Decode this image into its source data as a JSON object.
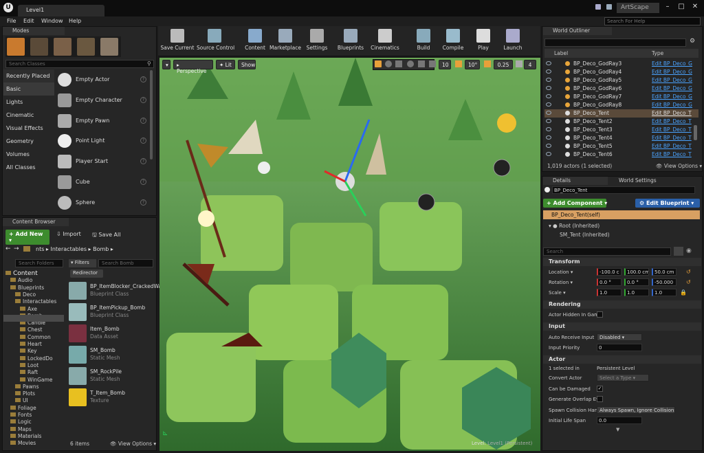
{
  "window": {
    "doc_tab": "Level1",
    "brand": "ArtScape",
    "help_search": "Search For Help"
  },
  "menu": [
    "File",
    "Edit",
    "Window",
    "Help"
  ],
  "modes": {
    "tab": "Modes",
    "search_placeholder": "Search Classes",
    "categories": [
      "Recently Placed",
      "Basic",
      "Lights",
      "Cinematic",
      "Visual Effects",
      "Geometry",
      "Volumes",
      "All Classes"
    ],
    "items": [
      "Empty Actor",
      "Empty Character",
      "Empty Pawn",
      "Point Light",
      "Player Start",
      "Cube",
      "Sphere"
    ]
  },
  "content_browser": {
    "tab": "Content Browser",
    "add_new": "Add New",
    "import": "Import",
    "save_all": "Save All",
    "path": [
      "nts",
      "Interactables",
      "Bomb"
    ],
    "folder_search": "Search Folders",
    "filters": "Filters",
    "asset_search": "Search Bomb",
    "filter_chip": "Redirector",
    "count": "6 items",
    "view_options": "View Options",
    "folders": [
      "Content",
      "Audio",
      "Blueprints",
      "Deco",
      "Interactables",
      "Axe",
      "Bomb",
      "Candle",
      "Chest",
      "Common",
      "Heart",
      "Key",
      "LockedDo",
      "Loot",
      "Raft",
      "WinGame",
      "Pawns",
      "Plots",
      "UI",
      "Foliage",
      "Fonts",
      "Logic",
      "Maps",
      "Materials",
      "Movies"
    ],
    "assets": [
      {
        "name": "BP_ItemBlocker_CrackedWa",
        "type": "Blueprint Class"
      },
      {
        "name": "BP_ItemPickup_Bomb",
        "type": "Blueprint Class"
      },
      {
        "name": "Item_Bomb",
        "type": "Data Asset"
      },
      {
        "name": "SM_Bomb",
        "type": "Static Mesh"
      },
      {
        "name": "SM_RockPile",
        "type": "Static Mesh"
      },
      {
        "name": "T_Item_Bomb",
        "type": "Texture"
      }
    ]
  },
  "toolbar": [
    "Save Current",
    "Source Control",
    "Content",
    "Marketplace",
    "Settings",
    "Blueprints",
    "Cinematics",
    "Build",
    "Compile",
    "Play",
    "Launch"
  ],
  "viewport": {
    "perspective": "Perspective",
    "lit": "Lit",
    "show": "Show",
    "grid": "10",
    "angle": "10°",
    "scale": "0.25",
    "cams": "4",
    "level_label": "Level:",
    "level_name": "Level1 (Persistent)"
  },
  "outliner": {
    "tab": "World Outliner",
    "col_label": "Label",
    "col_type": "Type",
    "rows": [
      {
        "label": "BP_Deco_GodRay3",
        "type": "Edit BP_Deco_G"
      },
      {
        "label": "BP_Deco_GodRay4",
        "type": "Edit BP_Deco_G"
      },
      {
        "label": "BP_Deco_GodRay5",
        "type": "Edit BP_Deco_G"
      },
      {
        "label": "BP_Deco_GodRay6",
        "type": "Edit BP_Deco_G"
      },
      {
        "label": "BP_Deco_GodRay7",
        "type": "Edit BP_Deco_G"
      },
      {
        "label": "BP_Deco_GodRay8",
        "type": "Edit BP_Deco_G"
      },
      {
        "label": "BP_Deco_Tent",
        "type": "Edit BP_Deco_T"
      },
      {
        "label": "BP_Deco_Tent2",
        "type": "Edit BP_Deco_T"
      },
      {
        "label": "BP_Deco_Tent3",
        "type": "Edit BP_Deco_T"
      },
      {
        "label": "BP_Deco_Tent4",
        "type": "Edit BP_Deco_T"
      },
      {
        "label": "BP_Deco_Tent5",
        "type": "Edit BP_Deco_T"
      },
      {
        "label": "BP_Deco_Tent6",
        "type": "Edit BP_Deco_T"
      }
    ],
    "status": "1,019 actors (1 selected)",
    "view_options": "View Options"
  },
  "details": {
    "tab": "Details",
    "tab2": "World Settings",
    "name": "BP_Deco_Tent",
    "add_component": "Add Component",
    "edit_blueprint": "Edit Blueprint",
    "self": "BP_Deco_Tent(self)",
    "root": "Root (Inherited)",
    "mesh": "SM_Tent (Inherited)",
    "search": "Search",
    "transform": "Transform",
    "location": "Location",
    "rotation": "Rotation",
    "scale": "Scale",
    "loc": [
      "-100.0 c",
      "100.0 cm",
      "50.0 cm"
    ],
    "rot": [
      "0.0 °",
      "0.0 °",
      "-50.000"
    ],
    "scl": [
      "1.0",
      "1.0",
      "1.0"
    ],
    "rendering": "Rendering",
    "actor_hidden": "Actor Hidden In Gam",
    "input": "Input",
    "auto_receive": "Auto Receive Input",
    "auto_receive_val": "Disabled",
    "input_priority": "Input Priority",
    "input_priority_val": "0",
    "actor": "Actor",
    "selected": "1 selected in",
    "persistent": "Persistent Level",
    "convert": "Convert Actor",
    "select_type": "Select a Type",
    "can_damage": "Can be Damaged",
    "gen_overlap": "Generate Overlap Ev",
    "spawn": "Spawn Collision Han",
    "spawn_val": "Always Spawn, Ignore Collisions",
    "life": "Initial Life Span",
    "life_val": "0.0"
  }
}
